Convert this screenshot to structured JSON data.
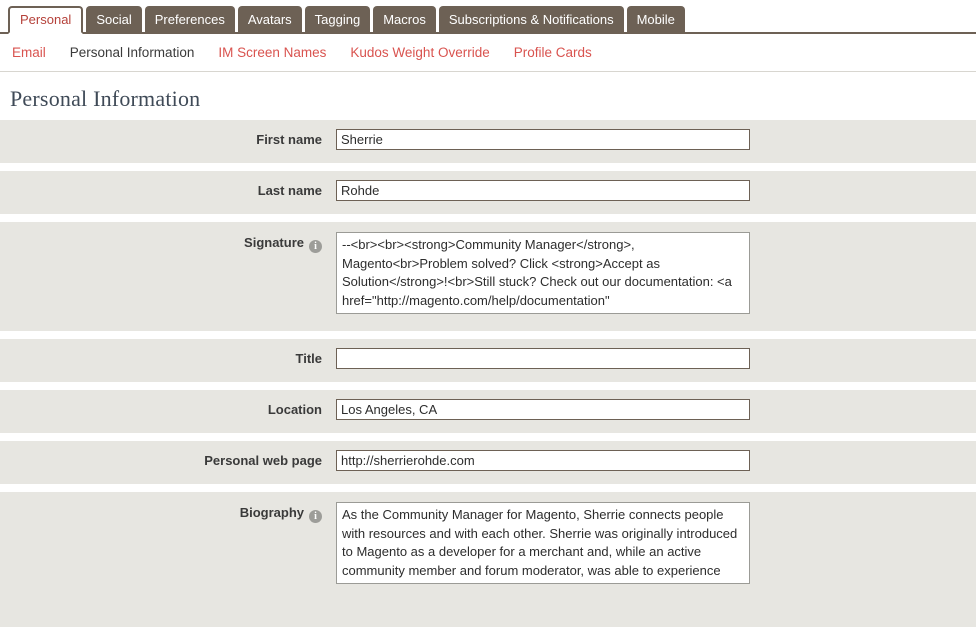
{
  "tabs": [
    {
      "label": "Personal",
      "active": true
    },
    {
      "label": "Social",
      "active": false
    },
    {
      "label": "Preferences",
      "active": false
    },
    {
      "label": "Avatars",
      "active": false
    },
    {
      "label": "Tagging",
      "active": false
    },
    {
      "label": "Macros",
      "active": false
    },
    {
      "label": "Subscriptions & Notifications",
      "active": false
    },
    {
      "label": "Mobile",
      "active": false
    }
  ],
  "subnav": [
    {
      "label": "Email",
      "current": false
    },
    {
      "label": "Personal Information",
      "current": true
    },
    {
      "label": "IM Screen Names",
      "current": false
    },
    {
      "label": "Kudos Weight Override",
      "current": false
    },
    {
      "label": "Profile Cards",
      "current": false
    }
  ],
  "page": {
    "heading": "Personal Information"
  },
  "fields": {
    "first_name": {
      "label": "First name",
      "value": "Sherrie",
      "placeholder": ""
    },
    "last_name": {
      "label": "Last name",
      "value": "Rohde",
      "placeholder": ""
    },
    "signature": {
      "label": "Signature",
      "info": "i",
      "value": "--<br><br><strong>Community Manager</strong>, Magento<br>Problem solved? Click <strong>Accept as Solution</strong>!<br>Still stuck? Check out our documentation: <a href=\"http://magento.com/help/documentation\"",
      "placeholder": ""
    },
    "title": {
      "label": "Title",
      "value": "",
      "placeholder": ""
    },
    "location": {
      "label": "Location",
      "value": "Los Angeles, CA",
      "placeholder": ""
    },
    "web_page": {
      "label": "Personal web page",
      "value": "http://sherrierohde.com",
      "placeholder": ""
    },
    "biography": {
      "label": "Biography",
      "info": "i",
      "value": "As the Community Manager for Magento, Sherrie connects people with resources and with each other. Sherrie was originally introduced to Magento as a developer for a merchant and, while an active community member and forum moderator, was able to experience working with the",
      "placeholder": ""
    }
  },
  "colors": {
    "tab_bar": "#6d6155",
    "tab_active_text": "#b5413a",
    "link": "#d9534f",
    "row_background": "#e7e6e1",
    "heading_text": "#3f4a57",
    "input_border": "#6d6155"
  }
}
